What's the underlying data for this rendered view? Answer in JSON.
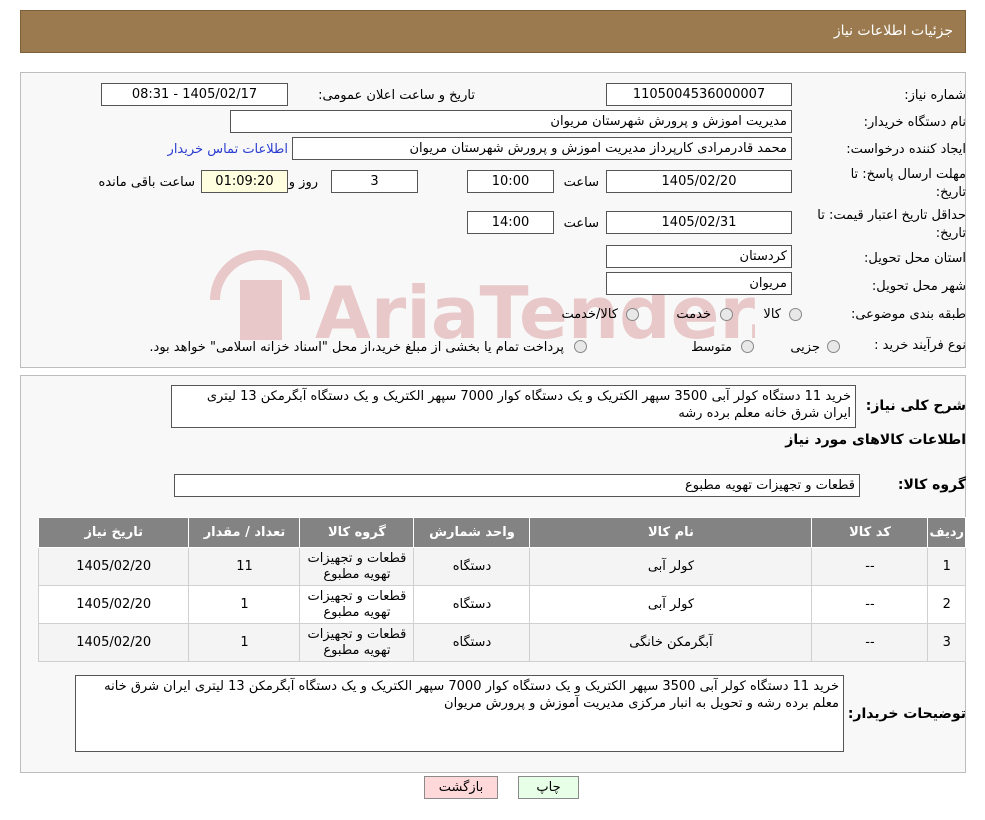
{
  "header": {
    "title": "جزئیات اطلاعات نیاز"
  },
  "watermark": {
    "text": "AriaTender.neT"
  },
  "info": {
    "need_number_label": "شماره نیاز:",
    "need_number": "1105004536000007",
    "announce_label": "تاریخ و ساعت اعلان عمومی:",
    "announce_value": "1405/02/17 - 08:31",
    "buyer_org_label": "نام دستگاه خریدار:",
    "buyer_org": "مدیریت اموزش و پرورش شهرستان مریوان",
    "requester_label": "ایجاد کننده درخواست:",
    "requester": "محمد قادرمرادی کارپرداز مدیریت اموزش و پرورش شهرستان مریوان",
    "contact_link": "اطلاعات تماس خریدار",
    "deadline_label_1": "مهلت ارسال پاسخ: تا",
    "deadline_label_2": "تاریخ:",
    "deadline_date": "1405/02/20",
    "time_label": "ساعت",
    "deadline_time": "10:00",
    "days_value": "3",
    "days_label": "روز و",
    "remaining_time": "01:09:20",
    "remaining_label": "ساعت باقی مانده",
    "price_validity_label_1": "حداقل تاریخ اعتبار قیمت: تا",
    "price_validity_label_2": "تاریخ:",
    "price_validity_date": "1405/02/31",
    "price_validity_time_label": "ساعت",
    "price_validity_time": "14:00",
    "province_label": "استان محل تحویل:",
    "province": "کردستان",
    "city_label": "شهر محل تحویل:",
    "city": "مریوان",
    "category_label": "طبقه بندی موضوعی:",
    "category_options": [
      "کالا",
      "خدمت",
      "کالا/خدمت"
    ],
    "process_label": "نوع فرآیند خرید :",
    "process_options": [
      "جزیی",
      "متوسط"
    ],
    "process_note": "پرداخت تمام یا بخشی از مبلغ خرید،از محل \"اسناد خزانه اسلامی\" خواهد بود."
  },
  "description": {
    "label": "شرح کلی نیاز:",
    "text": "خرید 11 دستگاه کولر آبی 3500 سپهر الکتریک و یک دستگاه کوار 7000 سپهر الکتریک و یک دستگاه آبگرمکن 13 لیتری  ایران شرق خانه معلم برده رشه"
  },
  "goods_section": {
    "title": "اطلاعات کالاهای مورد نیاز",
    "group_label": "گروه کالا:",
    "group_value": "قطعات و تجهیزات تهویه مطبوع"
  },
  "table": {
    "headers": [
      "ردیف",
      "کد کالا",
      "نام کالا",
      "واحد شمارش",
      "گروه کالا",
      "تعداد / مقدار",
      "تاریخ نیاز"
    ],
    "rows": [
      {
        "row": "1",
        "code": "--",
        "name": "کولر آبی",
        "unit": "دستگاه",
        "group_1": "قطعات و تجهیزات",
        "group_2": "تهویه مطبوع",
        "qty": "11",
        "date": "1405/02/20"
      },
      {
        "row": "2",
        "code": "--",
        "name": "کولر آبی",
        "unit": "دستگاه",
        "group_1": "قطعات و تجهیزات",
        "group_2": "تهویه مطبوع",
        "qty": "1",
        "date": "1405/02/20"
      },
      {
        "row": "3",
        "code": "--",
        "name": "آبگرمکن خانگی",
        "unit": "دستگاه",
        "group_1": "قطعات و تجهیزات",
        "group_2": "تهویه مطبوع",
        "qty": "1",
        "date": "1405/02/20"
      }
    ]
  },
  "buyer_notes": {
    "label": "توضیحات خریدار:",
    "text": "خرید 11 دستگاه کولر آبی 3500 سپهر الکتریک و یک دستگاه کوار 7000 سپهر الکتریک و یک دستگاه آبگرمکن 13 لیتری  ایران شرق خانه معلم برده رشه و تحویل به انبار مرکزی مدیریت آموزش و پرورش مریوان"
  },
  "buttons": {
    "back": "بازگشت",
    "print": "چاپ"
  },
  "colors": {
    "header_bg": "#9b7a4f",
    "table_header_bg": "#838383",
    "back_button_bg": "#ffd9d9",
    "print_button_bg": "#e6ffe6"
  }
}
